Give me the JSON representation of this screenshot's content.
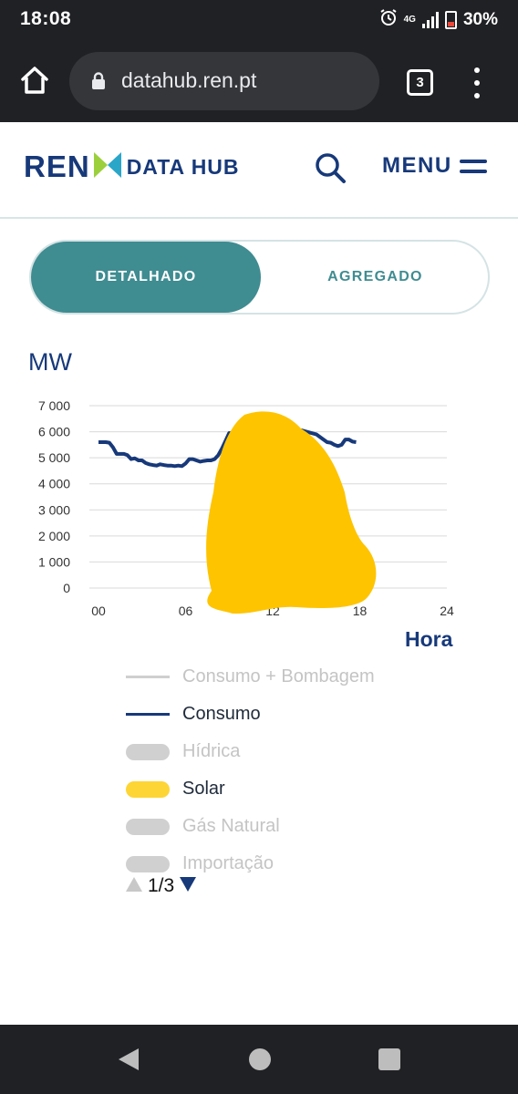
{
  "status_bar": {
    "time": "18:08",
    "net_type": "4G",
    "battery": "30%"
  },
  "browser": {
    "url": "datahub.ren.pt",
    "tab_count": "3"
  },
  "header": {
    "brand": "REN",
    "product": "DATA HUB",
    "menu_label": "MENU"
  },
  "toggle": {
    "options": [
      "DETALHADO",
      "AGREGADO"
    ],
    "selected": "DETALHADO"
  },
  "chart_data": {
    "type": "line",
    "ylabel": "MW",
    "xlabel": "Hora",
    "xlim": [
      0,
      24
    ],
    "ylim": [
      0,
      7000
    ],
    "x_ticks": [
      "00",
      "06",
      "12",
      "18",
      "24"
    ],
    "y_ticks": [
      "7 000",
      "6 000",
      "5 000",
      "4 000",
      "3 000",
      "2 000",
      "1 000",
      "0"
    ],
    "grid": true,
    "series": [
      {
        "name": "Consumo",
        "color": "#17397a",
        "x": [
          0,
          0.25,
          0.5,
          0.75,
          1,
          1.25,
          1.5,
          1.75,
          2,
          2.25,
          2.5,
          2.75,
          3,
          3.25,
          3.5,
          3.75,
          4,
          4.25,
          4.5,
          4.75,
          5,
          5.25,
          5.5,
          5.75,
          6,
          6.25,
          6.5,
          6.75,
          7,
          7.25,
          7.5,
          7.75,
          8,
          8.25,
          8.5,
          8.75,
          9,
          9.5,
          10,
          11,
          12,
          13,
          14,
          15,
          15.5,
          15.75,
          16,
          16.25,
          16.5,
          16.75,
          17,
          17.25,
          17.5,
          17.75
        ],
        "values": [
          5600,
          5600,
          5600,
          5580,
          5400,
          5150,
          5150,
          5150,
          5100,
          4950,
          4980,
          4900,
          4900,
          4800,
          4750,
          4720,
          4700,
          4750,
          4720,
          4700,
          4700,
          4680,
          4700,
          4680,
          4780,
          4950,
          4950,
          4900,
          4850,
          4880,
          4900,
          4900,
          4950,
          5100,
          5350,
          5650,
          5950,
          5950,
          5950,
          6050,
          6000,
          6100,
          6050,
          5900,
          5700,
          5600,
          5580,
          5500,
          5450,
          5500,
          5700,
          5700,
          5620,
          5600
        ]
      }
    ]
  },
  "legend": [
    {
      "label": "Consumo + Bombagem",
      "kind": "line",
      "color": "#cfcfcf",
      "enabled": false
    },
    {
      "label": "Consumo",
      "kind": "line",
      "color": "#17397a",
      "enabled": true
    },
    {
      "label": "Hídrica",
      "kind": "pill",
      "color": "#d0d0d0",
      "enabled": false
    },
    {
      "label": "Solar",
      "kind": "pill",
      "color": "#fdd535",
      "enabled": true
    },
    {
      "label": "Gás Natural",
      "kind": "pill",
      "color": "#d0d0d0",
      "enabled": false
    },
    {
      "label": "Importação",
      "kind": "pill",
      "color": "#d0d0d0",
      "enabled": false
    }
  ],
  "pager": {
    "text": "1/3"
  },
  "colors": {
    "brand_navy": "#17397a",
    "accent_teal": "#3f8c91",
    "redaction_yellow": "#fec400"
  }
}
